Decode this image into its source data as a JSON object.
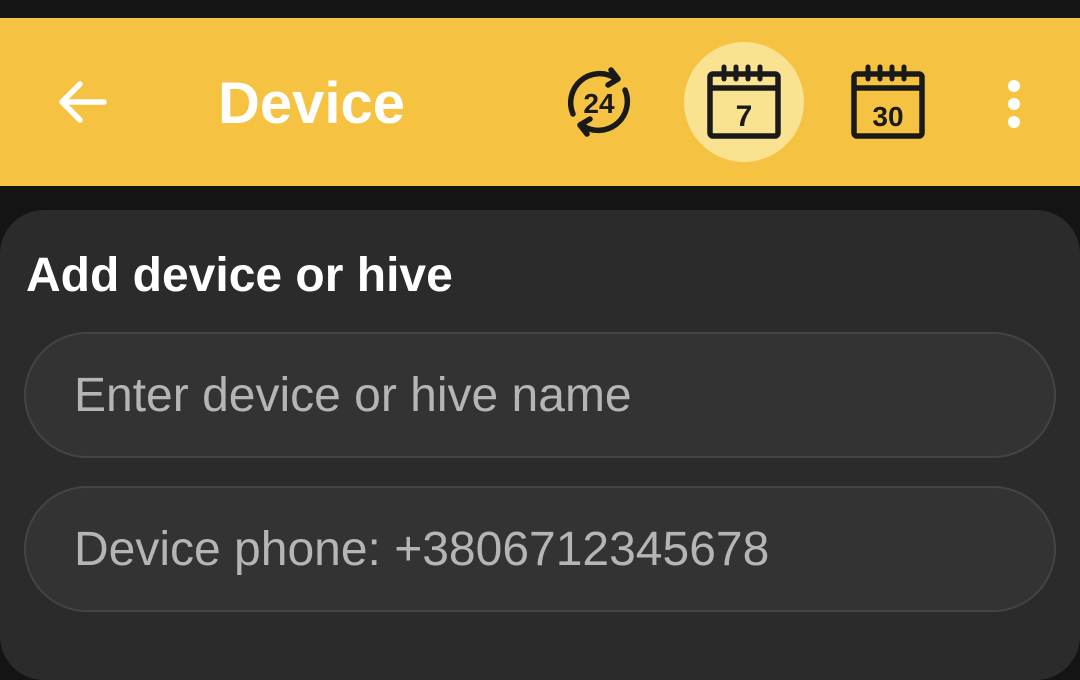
{
  "app_bar": {
    "title": "Device",
    "back_icon": "arrow-left-icon",
    "background": "#f5c242",
    "ranges": [
      {
        "label": "24",
        "icon": "refresh-24h-icon",
        "selected": false
      },
      {
        "label": "7",
        "icon": "calendar-7-icon",
        "selected": true
      },
      {
        "label": "30",
        "icon": "calendar-30-icon",
        "selected": false
      }
    ],
    "more_icon": "more-vertical-icon"
  },
  "form": {
    "heading": "Add device or hive",
    "name_input": {
      "value": "",
      "placeholder": "Enter device or hive name"
    },
    "phone_input": {
      "value": "",
      "placeholder": "Device phone: +3806712345678"
    }
  }
}
